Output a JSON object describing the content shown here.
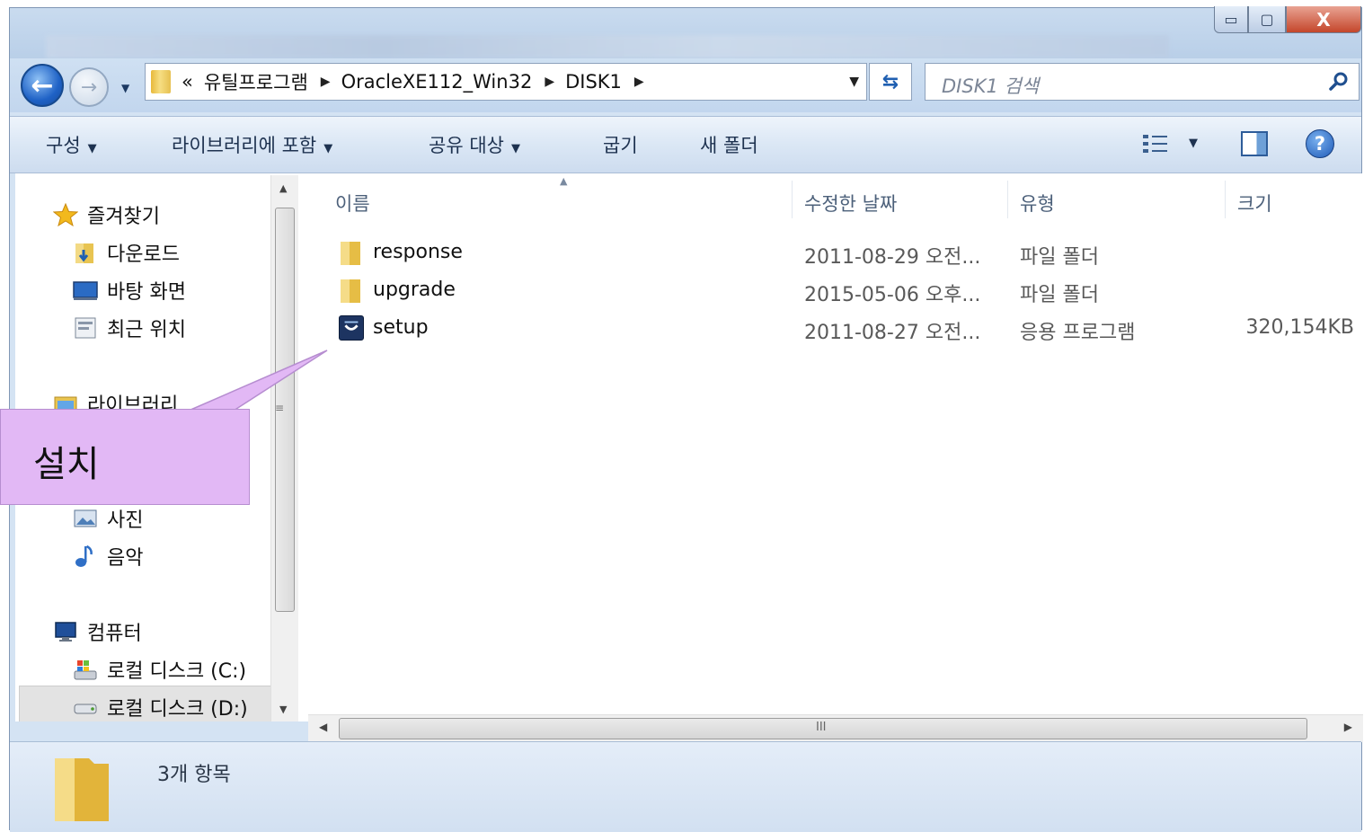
{
  "window": {
    "minimize_glyph": "▭",
    "maximize_glyph": "▢",
    "close_glyph": "X"
  },
  "nav": {
    "back_glyph": "←",
    "forward_glyph": "→",
    "breadcrumb_overflow": "«",
    "breadcrumb": [
      "유틸프로그램",
      "OracleXE112_Win32",
      "DISK1"
    ],
    "search_placeholder": "DISK1 검색"
  },
  "toolbar": {
    "organize": "구성",
    "include_library": "라이브러리에 포함",
    "share_with": "공유 대상",
    "burn": "굽기",
    "new_folder": "새 폴더",
    "help_glyph": "?"
  },
  "sidebar": {
    "favorites": "즐겨찾기",
    "downloads": "다운로드",
    "desktop": "바탕 화면",
    "recent": "최근 위치",
    "libraries": "라이브러리",
    "pictures": "사진",
    "music": "음악",
    "computer": "컴퓨터",
    "drive_c": "로컬 디스크 (C:)",
    "drive_d": "로컬 디스크 (D:)"
  },
  "columns": {
    "name": "이름",
    "modified": "수정한 날짜",
    "type": "유형",
    "size": "크기"
  },
  "files": [
    {
      "name": "response",
      "modified": "2011-08-29 오전...",
      "type": "파일 폴더",
      "size": "",
      "icon": "folder-icon"
    },
    {
      "name": "upgrade",
      "modified": "2015-05-06 오후...",
      "type": "파일 폴더",
      "size": "",
      "icon": "folder-icon"
    },
    {
      "name": "setup",
      "modified": "2011-08-27 오전...",
      "type": "응용 프로그램",
      "size": "320,154KB",
      "icon": "setup-app-icon"
    }
  ],
  "status": {
    "item_count": "3개 항목"
  },
  "annotation": {
    "callout_text": "설치"
  },
  "colors": {
    "callout_fill": "#e2b8f5",
    "toolbar_text": "#1e3250",
    "window_chrome": "#d4e3f3"
  }
}
